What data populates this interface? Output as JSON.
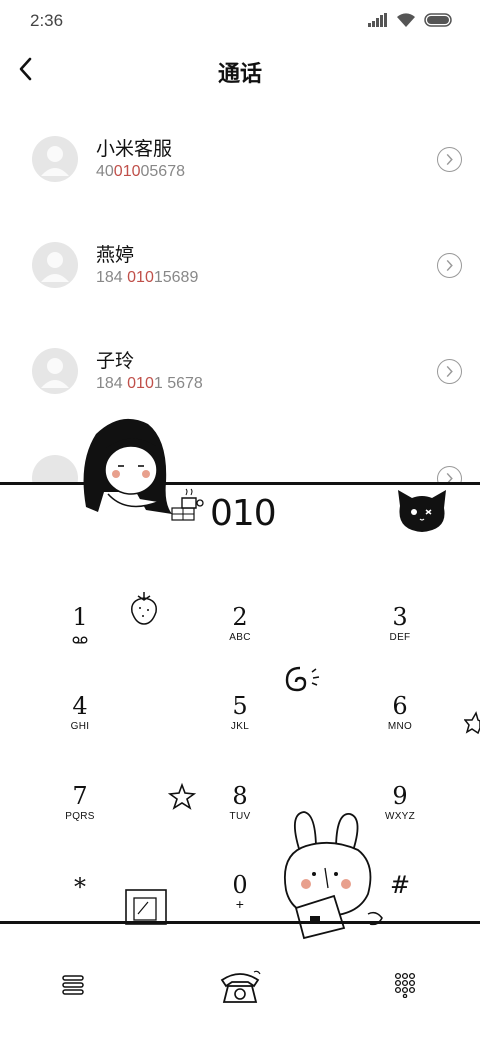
{
  "status": {
    "time": "2:36"
  },
  "header": {
    "title": "通话"
  },
  "contacts": [
    {
      "name": "小米客服",
      "num_pre": "40",
      "num_hl": "010",
      "num_post": "05678"
    },
    {
      "name": "燕婷",
      "num_pre": "184 ",
      "num_hl": "010",
      "num_post": "15689"
    },
    {
      "name": "子玲",
      "num_pre": "184 ",
      "num_hl": "010",
      "num_post": "1 5678"
    }
  ],
  "dialer": {
    "display": "010",
    "keys": [
      {
        "digit": "1",
        "letters": "voicemail-icon"
      },
      {
        "digit": "2",
        "letters": "ABC"
      },
      {
        "digit": "3",
        "letters": "DEF"
      },
      {
        "digit": "4",
        "letters": "GHI"
      },
      {
        "digit": "5",
        "letters": "JKL"
      },
      {
        "digit": "6",
        "letters": "MNO"
      },
      {
        "digit": "7",
        "letters": "PQRS"
      },
      {
        "digit": "8",
        "letters": "TUV"
      },
      {
        "digit": "9",
        "letters": "WXYZ"
      },
      {
        "digit": "*",
        "letters": ""
      },
      {
        "digit": "0",
        "letters": "+"
      },
      {
        "digit": "#",
        "letters": ""
      }
    ]
  },
  "bottom_nav": {
    "menu_icon": "menu-icon",
    "call_icon": "telephone-icon",
    "keypad_icon": "keypad-icon"
  },
  "colors": {
    "highlight": "#c0504a",
    "muted": "#888888",
    "line": "#111111"
  }
}
